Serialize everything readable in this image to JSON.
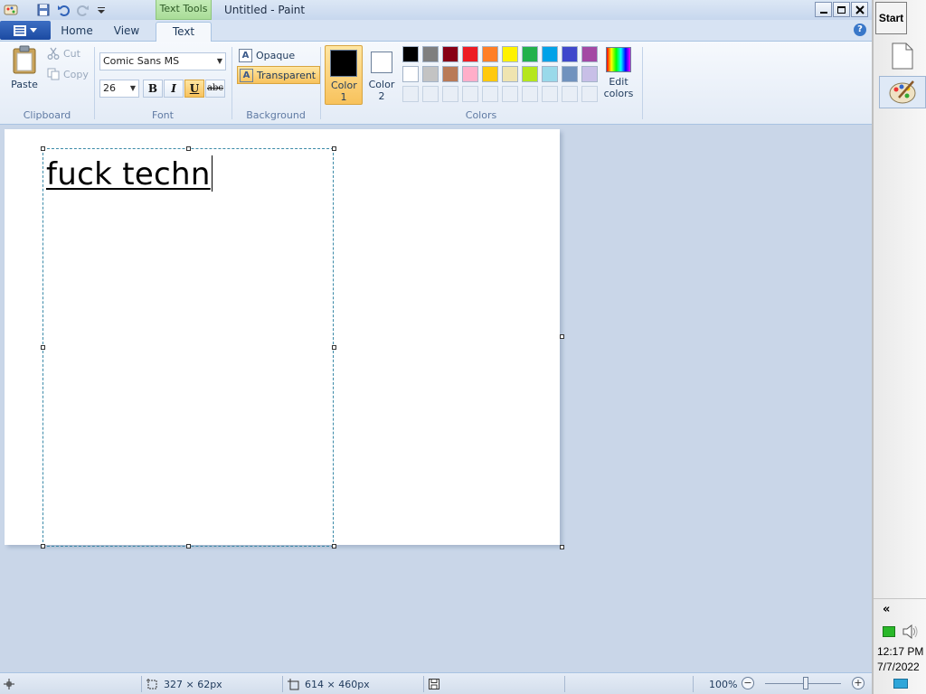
{
  "window": {
    "title": "Untitled - Paint",
    "contextual_tab": "Text Tools"
  },
  "tabs": [
    {
      "label": "Home",
      "active": false
    },
    {
      "label": "View",
      "active": false
    },
    {
      "label": "Text",
      "active": true
    }
  ],
  "ribbon": {
    "clipboard": {
      "group_label": "Clipboard",
      "paste": "Paste",
      "cut": "Cut",
      "copy": "Copy"
    },
    "font": {
      "group_label": "Font",
      "family": "Comic Sans MS",
      "size": "26",
      "bold": "B",
      "italic": "I",
      "underline": "U",
      "strikethrough": "abc",
      "underline_active": true
    },
    "background": {
      "group_label": "Background",
      "opaque": "Opaque",
      "transparent": "Transparent",
      "selected": "transparent"
    },
    "colors": {
      "group_label": "Colors",
      "color1_label": "Color 1",
      "color2_label": "Color 2",
      "color1": "#000000",
      "color2": "#ffffff",
      "edit_colors": "Edit colors",
      "palette_row1": [
        "#000000",
        "#7f7f7f",
        "#880015",
        "#ed1c24",
        "#ff7f27",
        "#fff200",
        "#22b14c",
        "#00a2e8",
        "#3f48cc",
        "#a349a4"
      ],
      "palette_row2": [
        "#ffffff",
        "#c3c3c3",
        "#b97a57",
        "#ffaec9",
        "#ffc90e",
        "#efe4b0",
        "#b5e61d",
        "#99d9ea",
        "#7092be",
        "#c8bfe7"
      ]
    }
  },
  "canvas": {
    "text": "fuck techn"
  },
  "status": {
    "selection_size": "327 × 62px",
    "image_size": "614 × 460px",
    "zoom": "100%"
  },
  "taskbar": {
    "start": "Start",
    "collapse": "«",
    "time": "12:17 PM",
    "date": "7/7/2022"
  }
}
